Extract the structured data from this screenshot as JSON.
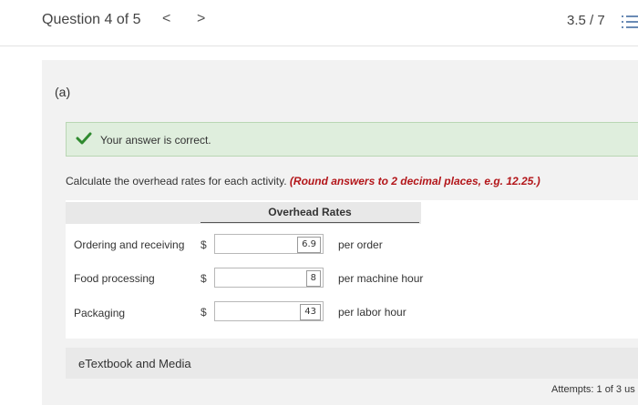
{
  "header": {
    "question_label": "Question 4 of 5",
    "prev_arrow": "<",
    "next_arrow": ">",
    "score": "3.5 / 7"
  },
  "part": {
    "label": "(a)"
  },
  "feedback": {
    "message": "Your answer is correct.",
    "status_color": "#dfeedd"
  },
  "instructions": {
    "text": "Calculate the overhead rates for each activity.",
    "round_note": "(Round answers to 2 decimal places, e.g. 12.25.)"
  },
  "table": {
    "column_header": "Overhead Rates",
    "rows": [
      {
        "label": "Ordering and receiving",
        "currency": "$",
        "value": "6.9",
        "unit": "per order"
      },
      {
        "label": "Food processing",
        "currency": "$",
        "value": "8",
        "unit": "per machine hour"
      },
      {
        "label": "Packaging",
        "currency": "$",
        "value": "43",
        "unit": "per labor hour"
      }
    ]
  },
  "resources": {
    "etextbook_label": "eTextbook and Media"
  },
  "footer": {
    "attempts": "Attempts: 1 of 3 us"
  },
  "icons": {
    "check": "check-icon",
    "menu": "list-menu-icon"
  }
}
